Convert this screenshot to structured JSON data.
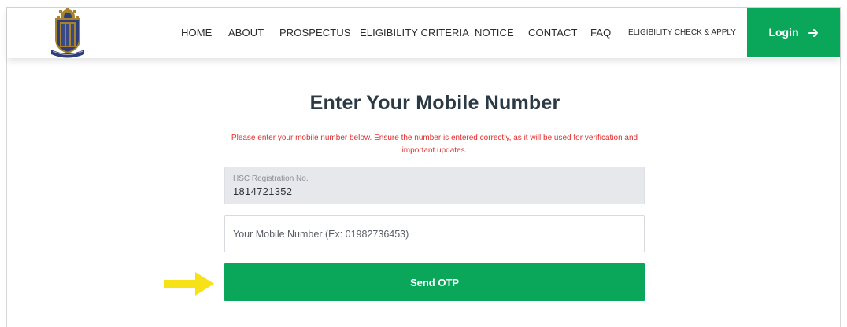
{
  "nav": {
    "items": [
      {
        "label": "HOME"
      },
      {
        "label": "ABOUT"
      },
      {
        "label": "PROSPECTUS"
      },
      {
        "label": "ELIGIBILITY CRITERIA"
      },
      {
        "label": "NOTICE"
      },
      {
        "label": "CONTACT"
      },
      {
        "label": "FAQ"
      },
      {
        "label": "ELIGIBILITY CHECK & APPLY"
      }
    ],
    "login_label": "Login"
  },
  "form": {
    "title": "Enter Your Mobile Number",
    "notice": "Please enter your mobile number below. Ensure the number is entered correctly, as it will be used for verification and important updates.",
    "registration": {
      "label": "HSC Registration No.",
      "value": "1814721352"
    },
    "mobile": {
      "placeholder": "Your Mobile Number (Ex: 01982736453)",
      "value": ""
    },
    "submit_label": "Send OTP"
  },
  "colors": {
    "accent": "#0aa65a",
    "notice_text": "#e22d2d",
    "title_text": "#2b3a45",
    "pointer_arrow": "#f7e117"
  },
  "icons": {
    "logo": "institution-crest-logo",
    "login": "arrow-right-icon",
    "pointer": "yellow-pointer-arrow"
  }
}
